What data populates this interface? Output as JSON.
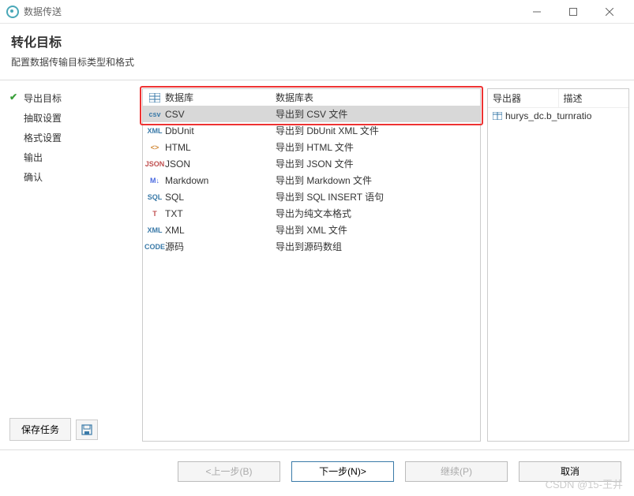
{
  "titlebar": {
    "title": "数据传送"
  },
  "header": {
    "title": "转化目标",
    "subtitle": "配置数据传输目标类型和格式"
  },
  "sidebar": {
    "steps": [
      {
        "label": "导出目标",
        "done": true
      },
      {
        "label": "抽取设置"
      },
      {
        "label": "格式设置"
      },
      {
        "label": "输出"
      },
      {
        "label": "确认"
      }
    ],
    "save_label": "保存任务"
  },
  "formats": [
    {
      "icon": "db",
      "name": "数据库",
      "desc": "数据库表"
    },
    {
      "icon": "csv",
      "name": "CSV",
      "desc": "导出到 CSV 文件",
      "selected": true
    },
    {
      "icon": "xml",
      "name": "DbUnit",
      "desc": "导出到 DbUnit XML 文件"
    },
    {
      "icon": "html",
      "name": "HTML",
      "desc": "导出到 HTML 文件"
    },
    {
      "icon": "json",
      "name": "JSON",
      "desc": "导出到 JSON 文件"
    },
    {
      "icon": "md",
      "name": "Markdown",
      "desc": "导出到 Markdown 文件"
    },
    {
      "icon": "sql",
      "name": "SQL",
      "desc": "导出到 SQL INSERT 语句"
    },
    {
      "icon": "txt",
      "name": "TXT",
      "desc": "导出为纯文本格式"
    },
    {
      "icon": "xml",
      "name": "XML",
      "desc": "导出到 XML 文件"
    },
    {
      "icon": "code",
      "name": "源码",
      "desc": "导出到源码数组"
    }
  ],
  "right_panel": {
    "col1": "导出器",
    "col2": "描述",
    "items": [
      {
        "label": "hurys_dc.b_turnratio"
      }
    ]
  },
  "footer": {
    "back": "<上一步(B)",
    "next": "下一步(N)>",
    "continue": "继续(P)",
    "cancel": "取消"
  },
  "watermark": "CSDN @15-王井"
}
